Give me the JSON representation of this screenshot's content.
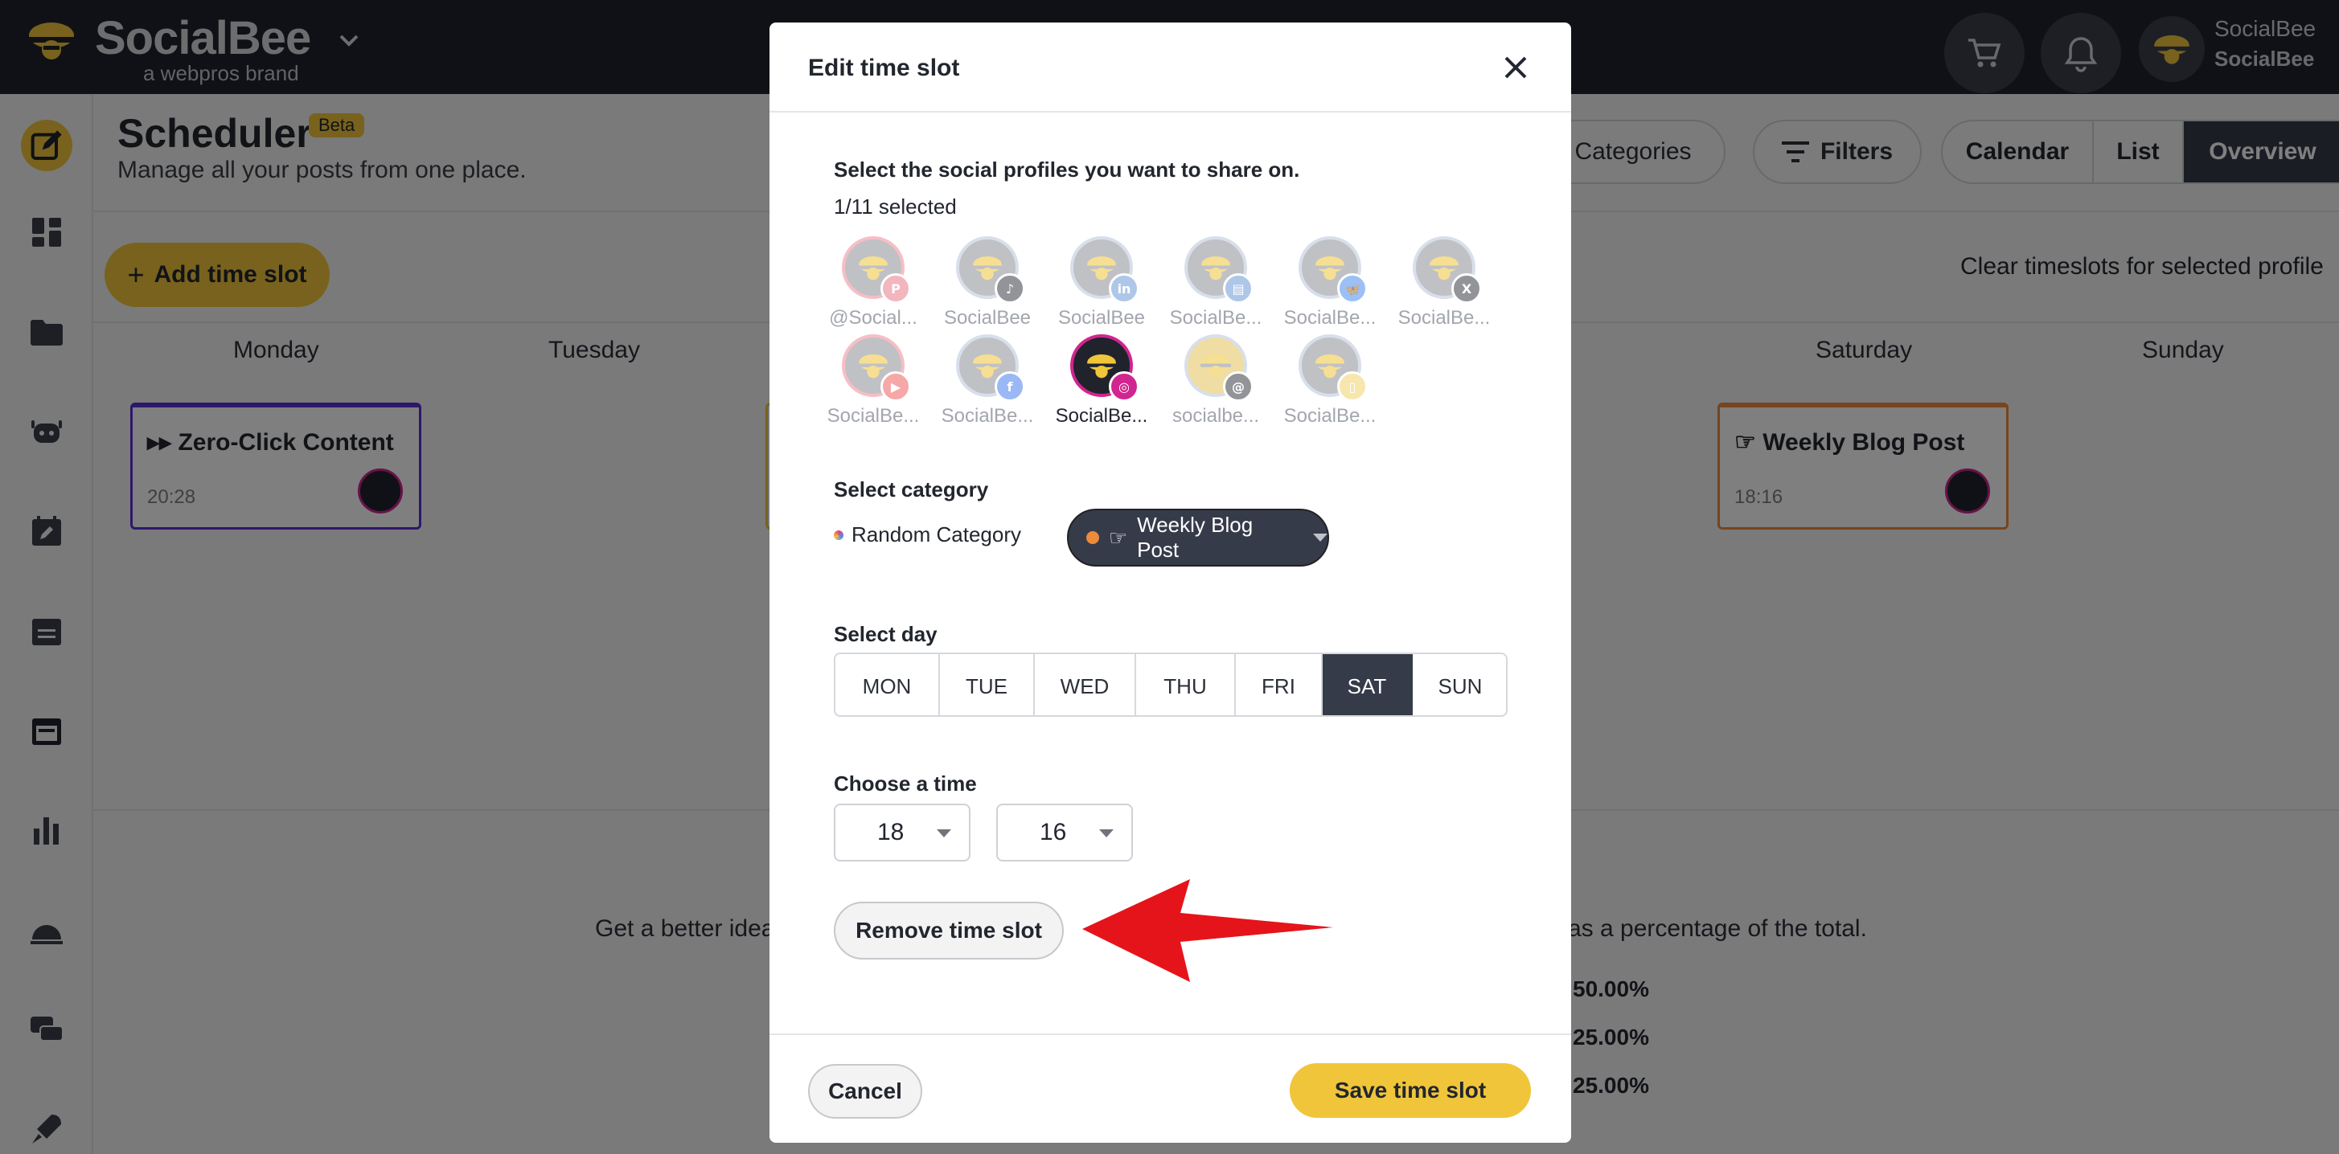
{
  "app": {
    "brand": "SocialBee",
    "brand_sub": "a webpros brand",
    "user_line1": "SocialBee",
    "user_line2": "SocialBee"
  },
  "page": {
    "title": "Scheduler",
    "beta_badge": "Beta",
    "subtitle": "Manage all your posts from one place."
  },
  "toolbar": {
    "categories_label": "Categories",
    "filters_label": "Filters",
    "view_tabs": [
      "Calendar",
      "List",
      "Overview"
    ],
    "active_view": "Overview",
    "add_time_slot": "Add time slot",
    "clear_timeslots": "Clear timeslots for selected profile"
  },
  "week": {
    "days": [
      "Monday",
      "Tuesday",
      "Saturday",
      "Sunday"
    ],
    "slots": [
      {
        "title": "Zero-Click Content",
        "time": "20:28",
        "icon": "double-chevron-right",
        "border": "#5b2fd6"
      },
      {
        "title": "Weekly Blog Post",
        "time": "18:16",
        "icon": "hand-pointing",
        "border": "#ee8a3c"
      }
    ]
  },
  "overview": {
    "text_left": "Get a better idea",
    "text_right": "as a percentage of the total.",
    "percentages": [
      "50.00%",
      "25.00%",
      "25.00%"
    ]
  },
  "modal": {
    "title": "Edit time slot",
    "profiles_heading": "Select the social profiles you want to share on.",
    "selected_count": "1/11 selected",
    "profiles": [
      {
        "label": "@Social...",
        "network": "pinterest",
        "color": "#e97b8b"
      },
      {
        "label": "SocialBee",
        "network": "tiktok",
        "color": "#3a3d44"
      },
      {
        "label": "SocialBee",
        "network": "linkedin",
        "color": "#6d9bd6"
      },
      {
        "label": "SocialBe...",
        "network": "google-business",
        "color": "#6d9bd6"
      },
      {
        "label": "SocialBe...",
        "network": "bluesky",
        "color": "#4a8ef0"
      },
      {
        "label": "SocialBe...",
        "network": "x",
        "color": "#3a3d44"
      },
      {
        "label": "SocialBe...",
        "network": "youtube",
        "color": "#f06060"
      },
      {
        "label": "SocialBe...",
        "network": "facebook",
        "color": "#4a7ff0"
      },
      {
        "label": "SocialBe...",
        "network": "instagram",
        "color": "#d1258f"
      },
      {
        "label": "socialbe...",
        "network": "threads",
        "color": "#3a3d44"
      },
      {
        "label": "SocialBe...",
        "network": "mobile",
        "color": "#f2d46a"
      }
    ],
    "category_heading": "Select category",
    "category_options": [
      "Random Category",
      "Weekly Blog Post"
    ],
    "category_selected": "Weekly Blog Post",
    "category_selected_icon": "hand-pointing",
    "day_heading": "Select day",
    "days": [
      "MON",
      "TUE",
      "WED",
      "THU",
      "FRI",
      "SAT",
      "SUN"
    ],
    "day_selected": "SAT",
    "time_heading": "Choose a time",
    "hour": "18",
    "minute": "16",
    "remove_label": "Remove time slot",
    "cancel_label": "Cancel",
    "save_label": "Save time slot"
  },
  "colors": {
    "accent": "#f0c53a",
    "dark": "#363b4a",
    "instagram": "#d1258f",
    "annotation_arrow": "#e5141b"
  }
}
